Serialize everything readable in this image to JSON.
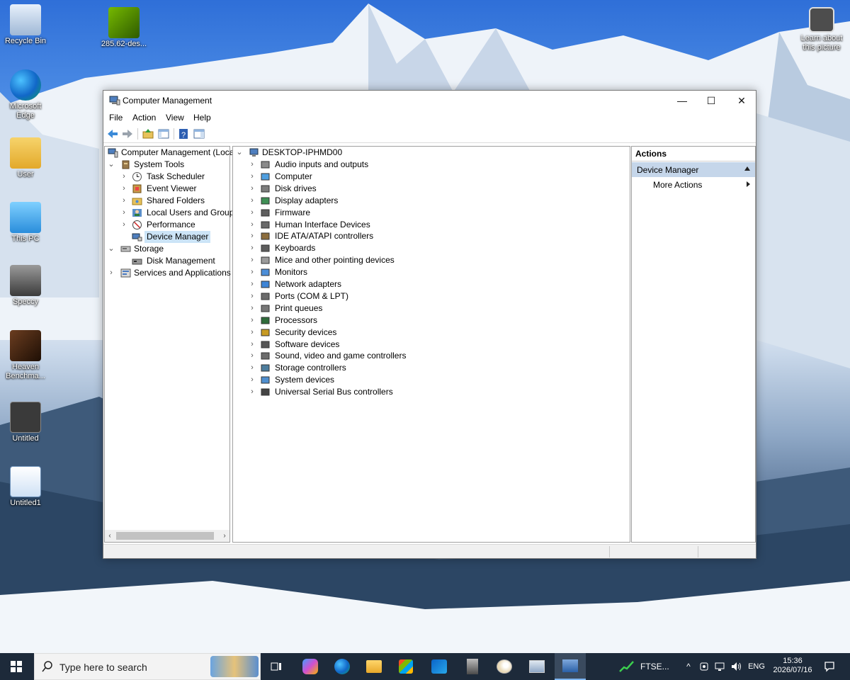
{
  "desktop": {
    "icons": [
      {
        "label": "Recycle Bin"
      },
      {
        "label": "285.62-des..."
      },
      {
        "label": "Microsoft Edge"
      },
      {
        "label": "User"
      },
      {
        "label": "This PC"
      },
      {
        "label": "Speccy"
      },
      {
        "label": "Heaven Benchma..."
      },
      {
        "label": "Untitled"
      },
      {
        "label": "Untitled1"
      }
    ],
    "learn_about": "Learn about this picture"
  },
  "window": {
    "title": "Computer Management",
    "controls": {
      "minimize": "—",
      "maximize": "☐",
      "close": "✕"
    },
    "menu": [
      "File",
      "Action",
      "View",
      "Help"
    ],
    "left_tree": [
      {
        "label": "Computer Management (Local",
        "expanded": true
      },
      {
        "label": "System Tools",
        "expanded": true
      },
      {
        "label": "Task Scheduler"
      },
      {
        "label": "Event Viewer"
      },
      {
        "label": "Shared Folders"
      },
      {
        "label": "Local Users and Groups"
      },
      {
        "label": "Performance"
      },
      {
        "label": "Device Manager",
        "selected": true
      },
      {
        "label": "Storage",
        "expanded": true
      },
      {
        "label": "Disk Management"
      },
      {
        "label": "Services and Applications"
      }
    ],
    "device_tree": {
      "root": "DESKTOP-IPHMD00",
      "categories": [
        "Audio inputs and outputs",
        "Computer",
        "Disk drives",
        "Display adapters",
        "Firmware",
        "Human Interface Devices",
        "IDE ATA/ATAPI controllers",
        "Keyboards",
        "Mice and other pointing devices",
        "Monitors",
        "Network adapters",
        "Ports (COM & LPT)",
        "Print queues",
        "Processors",
        "Security devices",
        "Software devices",
        "Sound, video and game controllers",
        "Storage controllers",
        "System devices",
        "Universal Serial Bus controllers"
      ]
    },
    "actions": {
      "header": "Actions",
      "section": "Device Manager",
      "items": [
        "More Actions"
      ]
    }
  },
  "taskbar": {
    "search_placeholder": "Type here to search",
    "ticker": "FTSE...",
    "language": "ENG",
    "time": "15:36",
    "date": "2026/07/16"
  },
  "colors": {
    "selection": "#cce4f7",
    "actions_section": "#c5d6ea",
    "taskbar": "#1d2a3a"
  }
}
